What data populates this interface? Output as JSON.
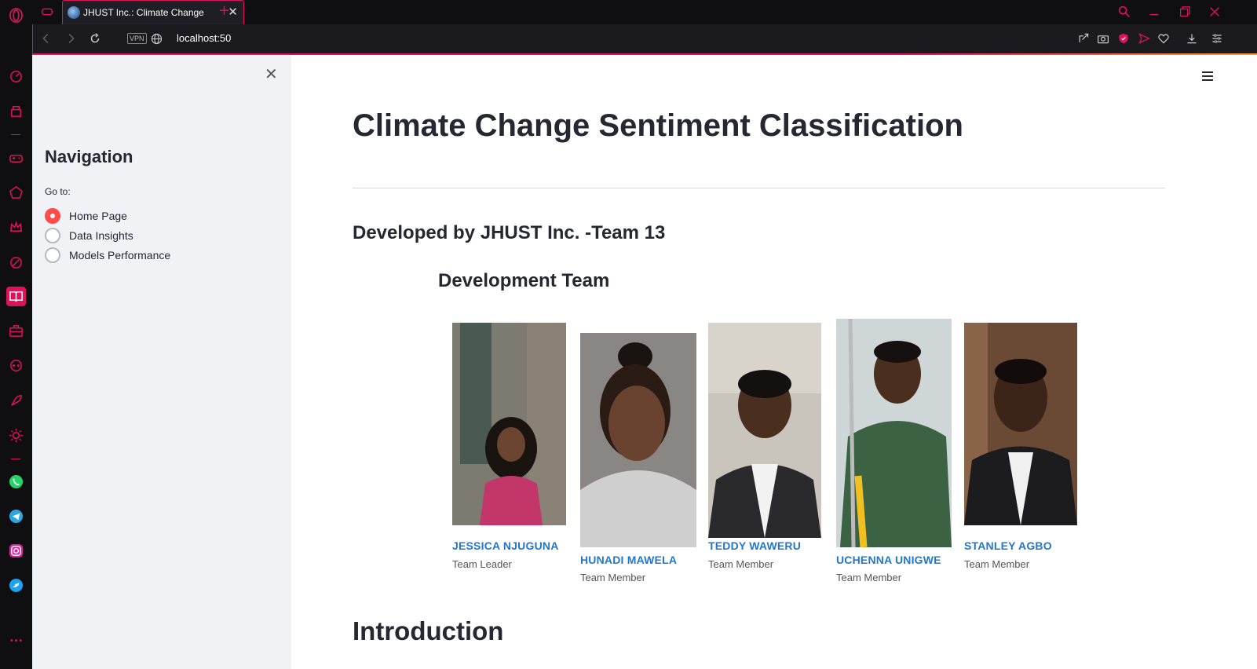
{
  "browser": {
    "tab_title": "JHUST Inc.: Climate Change",
    "url": "localhost:50",
    "vpn_label": "VPN",
    "accent": "#e0125a"
  },
  "sidebar": {
    "title": "Navigation",
    "goto_label": "Go to:",
    "options": [
      {
        "label": "Home Page",
        "selected": true
      },
      {
        "label": "Data Insights",
        "selected": false
      },
      {
        "label": "Models Performance",
        "selected": false
      }
    ]
  },
  "main": {
    "title": "Climate Change Sentiment Classification",
    "developed_by": "Developed by JHUST Inc. -Team 13",
    "team_heading": "Development Team",
    "members": [
      {
        "name": "JESSICA NJUGUNA",
        "role": "Team Leader"
      },
      {
        "name": "HUNADI MAWELA",
        "role": "Team Member"
      },
      {
        "name": "TEDDY WAWERU",
        "role": "Team Member"
      },
      {
        "name": "UCHENNA UNIGWE",
        "role": "Team Member"
      },
      {
        "name": "STANLEY AGBO",
        "role": "Team Member"
      }
    ],
    "intro_heading": "Introduction"
  },
  "colors": {
    "radio_selected": "#ff4b4b",
    "member_name": "#2277cc",
    "sidebar_bg": "#f0f2f6"
  }
}
